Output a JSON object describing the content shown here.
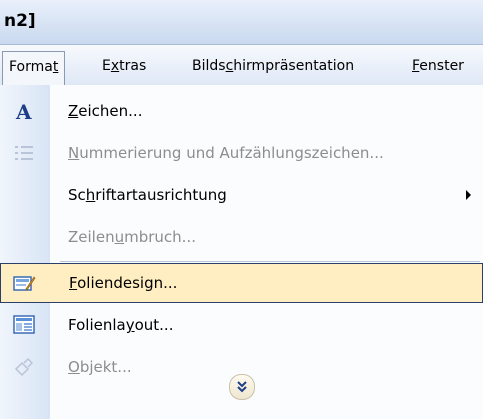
{
  "window": {
    "title": "n2]"
  },
  "menubar": {
    "items": [
      {
        "key": "format",
        "pre": "Forma",
        "acc": "t",
        "post": ""
      },
      {
        "key": "extras",
        "pre": "E",
        "acc": "x",
        "post": "tras"
      },
      {
        "key": "bildschirm",
        "pre": "Bilds",
        "acc": "c",
        "post": "hirmpräsentation"
      },
      {
        "key": "fenster",
        "pre": "",
        "acc": "F",
        "post": "enster"
      }
    ]
  },
  "menu": {
    "items": [
      {
        "pre": "",
        "acc": "Z",
        "post": "eichen...",
        "icon": "font-A-icon",
        "disabled": false,
        "submenu": false,
        "highlighted": false
      },
      {
        "pre": "",
        "acc": "N",
        "post": "ummerierung und Aufzählungszeichen...",
        "icon": "bullet-list-icon",
        "disabled": true,
        "submenu": false,
        "highlighted": false
      },
      {
        "pre": "Sc",
        "acc": "h",
        "post": "riftartausrichtung",
        "icon": "",
        "disabled": false,
        "submenu": true,
        "highlighted": false
      },
      {
        "pre": "Zeilen",
        "acc": "u",
        "post": "mbruch...",
        "icon": "",
        "disabled": true,
        "submenu": false,
        "highlighted": false
      },
      {
        "pre": "",
        "acc": "F",
        "post": "oliendesign...",
        "icon": "slide-design-icon",
        "disabled": false,
        "submenu": false,
        "highlighted": true
      },
      {
        "pre": "Folienla",
        "acc": "y",
        "post": "out...",
        "icon": "slide-layout-icon",
        "disabled": false,
        "submenu": false,
        "highlighted": false
      },
      {
        "pre": "",
        "acc": "O",
        "post": "bjekt...",
        "icon": "object-icon",
        "disabled": true,
        "submenu": false,
        "highlighted": false
      }
    ],
    "expand_icon": "double-chevron-down-icon"
  },
  "colors": {
    "highlight": "#ffeec2",
    "highlight_border": "#2b3f6b",
    "disabled_text": "#8d8d8d"
  }
}
